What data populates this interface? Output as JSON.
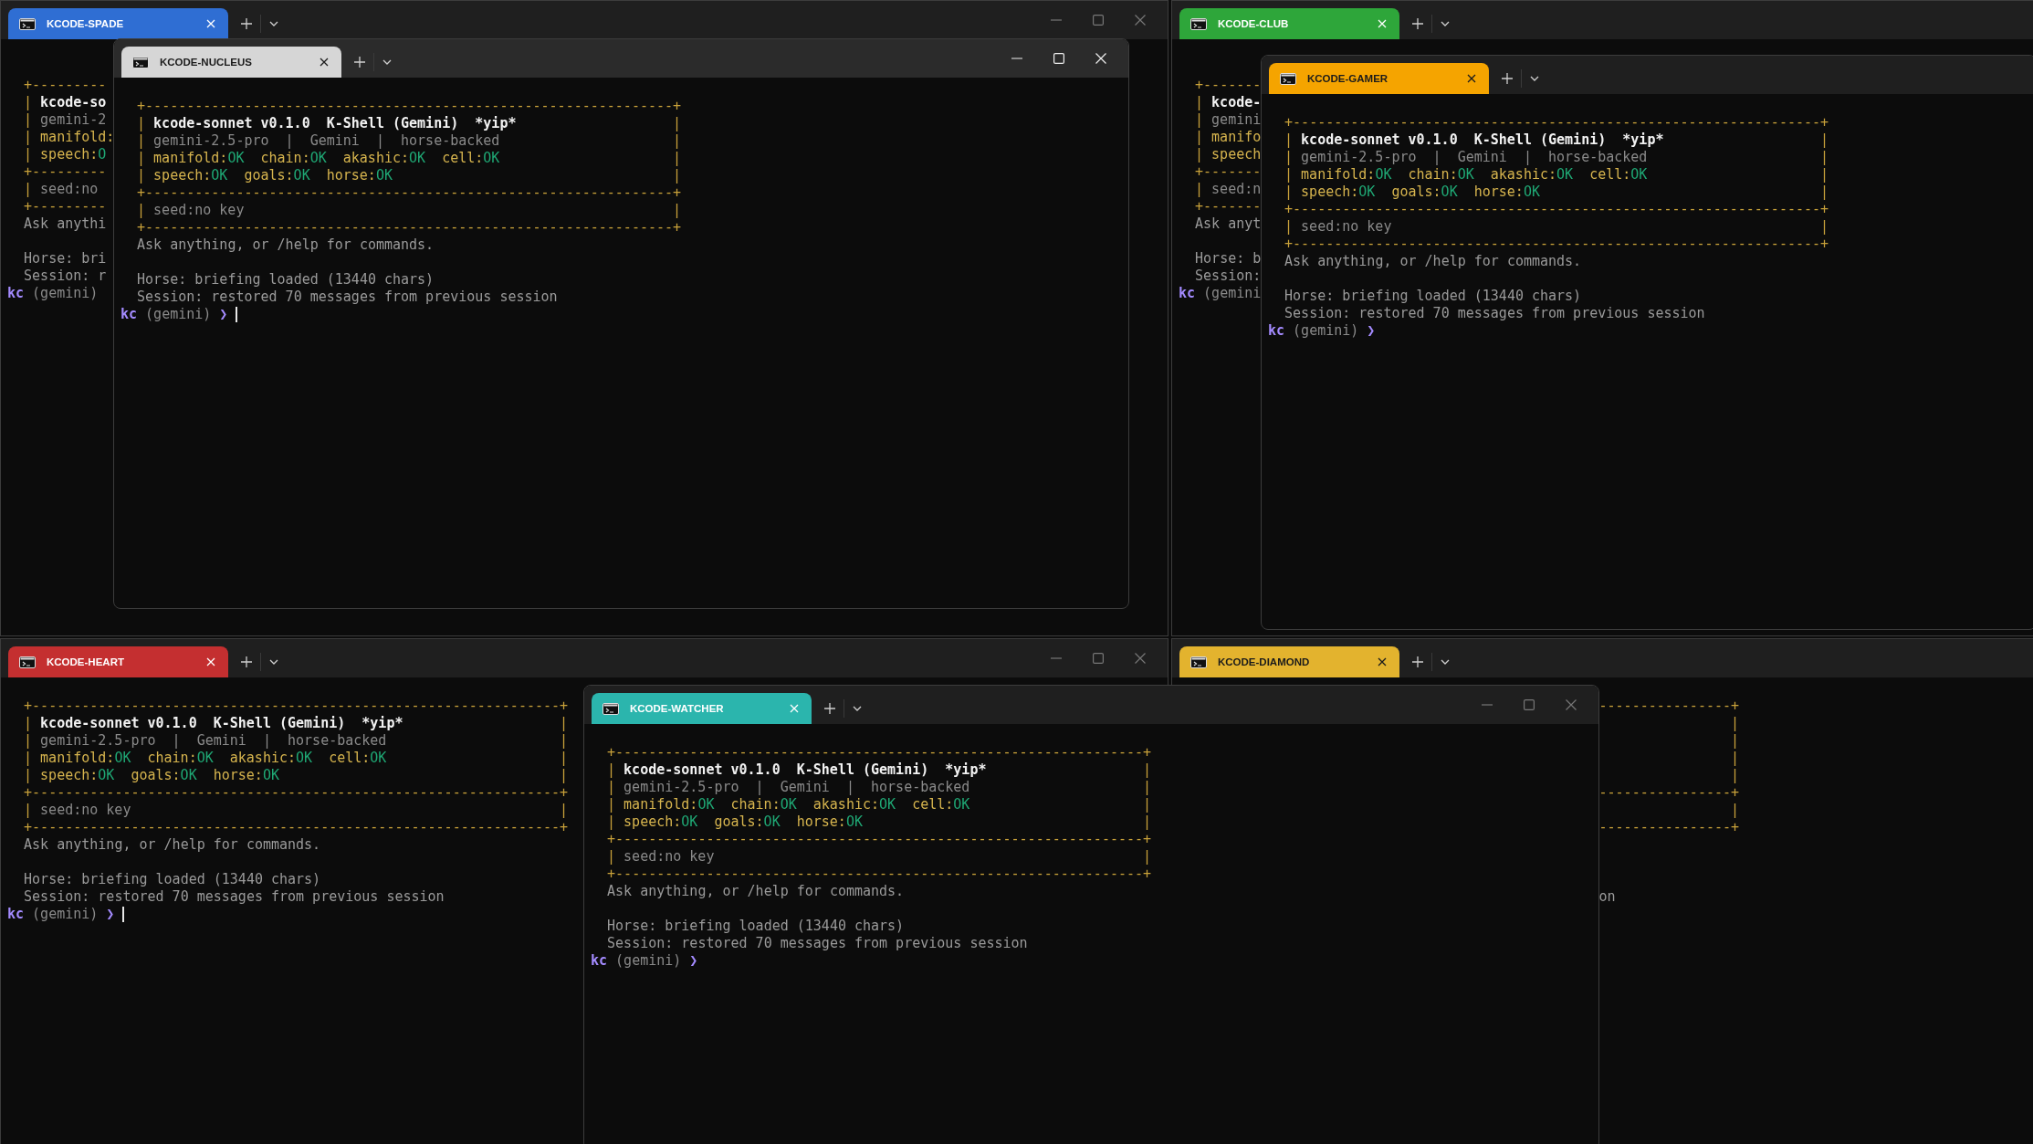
{
  "windows": [
    {
      "tab": {
        "title": "KCODE-SPADE",
        "color": "#2f6ed3"
      },
      "controls": true,
      "focused": false,
      "kind": "head",
      "lines": [
        {
          "kind": "blank"
        },
        {
          "kind": "border",
          "text": "+---------"
        },
        {
          "kind": "row",
          "edge": "|",
          "items": [
            {
              "kind": "title",
              "text": "kcode-so"
            }
          ]
        },
        {
          "kind": "row",
          "edge": "|",
          "items": [
            {
              "kind": "dim",
              "text": "gemini-2"
            }
          ]
        },
        {
          "kind": "row",
          "edge": "|",
          "items": [
            {
              "kind": "status",
              "label": "manifold:"
            }
          ]
        },
        {
          "kind": "row",
          "edge": "|",
          "items": [
            {
              "kind": "status",
              "label": "speech:",
              "value": "O"
            }
          ]
        },
        {
          "kind": "border",
          "text": "+---------"
        },
        {
          "kind": "row",
          "edge": "|",
          "items": [
            {
              "kind": "dim",
              "text": "seed:no"
            }
          ]
        },
        {
          "kind": "border",
          "text": "+---------"
        },
        {
          "kind": "text",
          "text": "Ask anythi"
        },
        {
          "kind": "blank"
        },
        {
          "kind": "text",
          "text": "Horse: bri"
        },
        {
          "kind": "text",
          "text": "Session: r"
        },
        {
          "kind": "prompt",
          "user": "kc",
          "context": "(gemini)",
          "cursor": false
        }
      ]
    },
    {
      "tab": {
        "title": "KCODE-NUCLEUS",
        "color": "#d6d6d6"
      },
      "controls": true,
      "focused": true,
      "kind": "full",
      "lines": [
        {
          "kind": "border",
          "text": "+----------------------------------------------------------------+"
        },
        {
          "kind": "row",
          "edge": "|",
          "items": [
            {
              "kind": "title",
              "text": "kcode-sonnet v0.1.0  K-Shell (Gemini)  *yip*"
            }
          ],
          "end": "|"
        },
        {
          "kind": "row",
          "edge": "|",
          "items": [
            {
              "kind": "dim",
              "text": "gemini-2.5-pro  |  Gemini  |  horse-backed"
            }
          ],
          "end": "|"
        },
        {
          "kind": "row",
          "edge": "|",
          "items": [
            {
              "kind": "status",
              "label": "manifold:",
              "value": "OK"
            },
            {
              "kind": "status",
              "label": "chain:",
              "value": "OK"
            },
            {
              "kind": "status",
              "label": "akashic:",
              "value": "OK"
            },
            {
              "kind": "status",
              "label": "cell:",
              "value": "OK"
            }
          ],
          "end": "|"
        },
        {
          "kind": "row",
          "edge": "|",
          "items": [
            {
              "kind": "status",
              "label": "speech:",
              "value": "OK"
            },
            {
              "kind": "status",
              "label": "goals:",
              "value": "OK"
            },
            {
              "kind": "status",
              "label": "horse:",
              "value": "OK"
            }
          ],
          "end": "|"
        },
        {
          "kind": "border",
          "text": "+----------------------------------------------------------------+"
        },
        {
          "kind": "row",
          "edge": "|",
          "items": [
            {
              "kind": "dim",
              "text": "seed:no key"
            }
          ],
          "end": "|"
        },
        {
          "kind": "border",
          "text": "+----------------------------------------------------------------+"
        },
        {
          "kind": "text",
          "text": "Ask anything, or /help for commands."
        },
        {
          "kind": "blank"
        },
        {
          "kind": "text",
          "text": "Horse: briefing loaded (13440 chars)"
        },
        {
          "kind": "text",
          "text": "Session: restored 70 messages from previous session"
        },
        {
          "kind": "prompt",
          "user": "kc",
          "context": "(gemini)",
          "symbol": "❯",
          "cursor": true
        }
      ]
    },
    {
      "tab": {
        "title": "KCODE-CLUB",
        "color": "#2ea63a"
      },
      "controls": false,
      "focused": false,
      "kind": "head",
      "lines": [
        {
          "kind": "blank"
        },
        {
          "kind": "border",
          "text": "+-------"
        },
        {
          "kind": "row",
          "edge": "|",
          "items": [
            {
              "kind": "title",
              "text": "kcode-"
            }
          ]
        },
        {
          "kind": "row",
          "edge": "|",
          "items": [
            {
              "kind": "dim",
              "text": "gemini"
            }
          ]
        },
        {
          "kind": "row",
          "edge": "|",
          "items": [
            {
              "kind": "status",
              "label": "manifo"
            }
          ]
        },
        {
          "kind": "row",
          "edge": "|",
          "items": [
            {
              "kind": "status",
              "label": "speech"
            }
          ]
        },
        {
          "kind": "border",
          "text": "+-------"
        },
        {
          "kind": "row",
          "edge": "|",
          "items": [
            {
              "kind": "dim",
              "text": "seed:n"
            }
          ]
        },
        {
          "kind": "border",
          "text": "+-------"
        },
        {
          "kind": "text",
          "text": "Ask anyt"
        },
        {
          "kind": "blank"
        },
        {
          "kind": "text",
          "text": "Horse: b"
        },
        {
          "kind": "text",
          "text": "Session:"
        },
        {
          "kind": "prompt",
          "user": "kc",
          "context": "(gemini",
          "cursor": false
        }
      ]
    },
    {
      "tab": {
        "title": "KCODE-GAMER",
        "color": "#f5a400"
      },
      "controls": false,
      "focused": false,
      "kind": "full",
      "lines": [
        {
          "kind": "border",
          "text": "+----------------------------------------------------------------+"
        },
        {
          "kind": "row",
          "edge": "|",
          "items": [
            {
              "kind": "title",
              "text": "kcode-sonnet v0.1.0  K-Shell (Gemini)  *yip*"
            }
          ],
          "end": "|"
        },
        {
          "kind": "row",
          "edge": "|",
          "items": [
            {
              "kind": "dim",
              "text": "gemini-2.5-pro  |  Gemini  |  horse-backed"
            }
          ],
          "end": "|"
        },
        {
          "kind": "row",
          "edge": "|",
          "items": [
            {
              "kind": "status",
              "label": "manifold:",
              "value": "OK"
            },
            {
              "kind": "status",
              "label": "chain:",
              "value": "OK"
            },
            {
              "kind": "status",
              "label": "akashic:",
              "value": "OK"
            },
            {
              "kind": "status",
              "label": "cell:",
              "value": "OK"
            }
          ],
          "end": "|"
        },
        {
          "kind": "row",
          "edge": "|",
          "items": [
            {
              "kind": "status",
              "label": "speech:",
              "value": "OK"
            },
            {
              "kind": "status",
              "label": "goals:",
              "value": "OK"
            },
            {
              "kind": "status",
              "label": "horse:",
              "value": "OK"
            }
          ],
          "end": "|"
        },
        {
          "kind": "border",
          "text": "+----------------------------------------------------------------+"
        },
        {
          "kind": "row",
          "edge": "|",
          "items": [
            {
              "kind": "dim",
              "text": "seed:no key"
            }
          ],
          "end": "|"
        },
        {
          "kind": "border",
          "text": "+----------------------------------------------------------------+"
        },
        {
          "kind": "text",
          "text": "Ask anything, or /help for commands."
        },
        {
          "kind": "blank"
        },
        {
          "kind": "text",
          "text": "Horse: briefing loaded (13440 chars)"
        },
        {
          "kind": "text",
          "text": "Session: restored 70 messages from previous session"
        },
        {
          "kind": "prompt",
          "user": "kc",
          "context": "(gemini)",
          "symbol": "❯",
          "cursor": false
        }
      ]
    },
    {
      "tab": {
        "title": "KCODE-HEART",
        "color": "#c42f30"
      },
      "controls": true,
      "focused": false,
      "kind": "full",
      "lines": [
        {
          "kind": "border",
          "text": "+----------------------------------------------------------------+"
        },
        {
          "kind": "row",
          "edge": "|",
          "items": [
            {
              "kind": "title",
              "text": "kcode-sonnet v0.1.0  K-Shell (Gemini)  *yip*"
            }
          ],
          "end": "|"
        },
        {
          "kind": "row",
          "edge": "|",
          "items": [
            {
              "kind": "dim",
              "text": "gemini-2.5-pro  |  Gemini  |  horse-backed"
            }
          ],
          "end": "|"
        },
        {
          "kind": "row",
          "edge": "|",
          "items": [
            {
              "kind": "status",
              "label": "manifold:",
              "value": "OK"
            },
            {
              "kind": "status",
              "label": "chain:",
              "value": "OK"
            },
            {
              "kind": "status",
              "label": "akashic:",
              "value": "OK"
            },
            {
              "kind": "status",
              "label": "cell:",
              "value": "OK"
            }
          ],
          "end": "|"
        },
        {
          "kind": "row",
          "edge": "|",
          "items": [
            {
              "kind": "status",
              "label": "speech:",
              "value": "OK"
            },
            {
              "kind": "status",
              "label": "goals:",
              "value": "OK"
            },
            {
              "kind": "status",
              "label": "horse:",
              "value": "OK"
            }
          ],
          "end": "|"
        },
        {
          "kind": "border",
          "text": "+----------------------------------------------------------------+"
        },
        {
          "kind": "row",
          "edge": "|",
          "items": [
            {
              "kind": "dim",
              "text": "seed:no key"
            }
          ],
          "end": "|"
        },
        {
          "kind": "border",
          "text": "+----------------------------------------------------------------+"
        },
        {
          "kind": "text",
          "text": "Ask anything, or /help for commands."
        },
        {
          "kind": "blank"
        },
        {
          "kind": "text",
          "text": "Horse: briefing loaded (13440 chars)"
        },
        {
          "kind": "text",
          "text": "Session: restored 70 messages from previous session"
        },
        {
          "kind": "prompt",
          "user": "kc",
          "context": "(gemini)",
          "symbol": "❯",
          "cursor": true
        }
      ]
    },
    {
      "tab": {
        "title": "KCODE-WATCHER",
        "color": "#2bb5ad"
      },
      "controls": true,
      "focused": false,
      "kind": "full",
      "lines": [
        {
          "kind": "border",
          "text": "+----------------------------------------------------------------+"
        },
        {
          "kind": "row",
          "edge": "|",
          "items": [
            {
              "kind": "title",
              "text": "kcode-sonnet v0.1.0  K-Shell (Gemini)  *yip*"
            }
          ],
          "end": "|"
        },
        {
          "kind": "row",
          "edge": "|",
          "items": [
            {
              "kind": "dim",
              "text": "gemini-2.5-pro  |  Gemini  |  horse-backed"
            }
          ],
          "end": "|"
        },
        {
          "kind": "row",
          "edge": "|",
          "items": [
            {
              "kind": "status",
              "label": "manifold:",
              "value": "OK"
            },
            {
              "kind": "status",
              "label": "chain:",
              "value": "OK"
            },
            {
              "kind": "status",
              "label": "akashic:",
              "value": "OK"
            },
            {
              "kind": "status",
              "label": "cell:",
              "value": "OK"
            }
          ],
          "end": "|"
        },
        {
          "kind": "row",
          "edge": "|",
          "items": [
            {
              "kind": "status",
              "label": "speech:",
              "value": "OK"
            },
            {
              "kind": "status",
              "label": "goals:",
              "value": "OK"
            },
            {
              "kind": "status",
              "label": "horse:",
              "value": "OK"
            }
          ],
          "end": "|"
        },
        {
          "kind": "border",
          "text": "+----------------------------------------------------------------+"
        },
        {
          "kind": "row",
          "edge": "|",
          "items": [
            {
              "kind": "dim",
              "text": "seed:no key"
            }
          ],
          "end": "|"
        },
        {
          "kind": "border",
          "text": "+----------------------------------------------------------------+"
        },
        {
          "kind": "text",
          "text": "Ask anything, or /help for commands."
        },
        {
          "kind": "blank"
        },
        {
          "kind": "text",
          "text": "Horse: briefing loaded (13440 chars)"
        },
        {
          "kind": "text",
          "text": "Session: restored 70 messages from previous session"
        },
        {
          "kind": "prompt",
          "user": "kc",
          "context": "(gemini)",
          "symbol": "❯",
          "cursor": false
        }
      ]
    },
    {
      "tab": {
        "title": "KCODE-DIAMOND",
        "color": "#e3b32e"
      },
      "controls": false,
      "focused": false,
      "kind": "tail",
      "lines": [
        {
          "kind": "border",
          "text": "----------------+"
        },
        {
          "kind": "row",
          "end": "|"
        },
        {
          "kind": "row",
          "end": "|"
        },
        {
          "kind": "row",
          "end": "|"
        },
        {
          "kind": "row",
          "end": "|"
        },
        {
          "kind": "border",
          "text": "----------------+"
        },
        {
          "kind": "row",
          "end": "|"
        },
        {
          "kind": "border",
          "text": "----------------+"
        },
        {
          "kind": "blank"
        },
        {
          "kind": "blank"
        },
        {
          "kind": "blank"
        },
        {
          "kind": "text",
          "text": "on"
        }
      ]
    }
  ]
}
